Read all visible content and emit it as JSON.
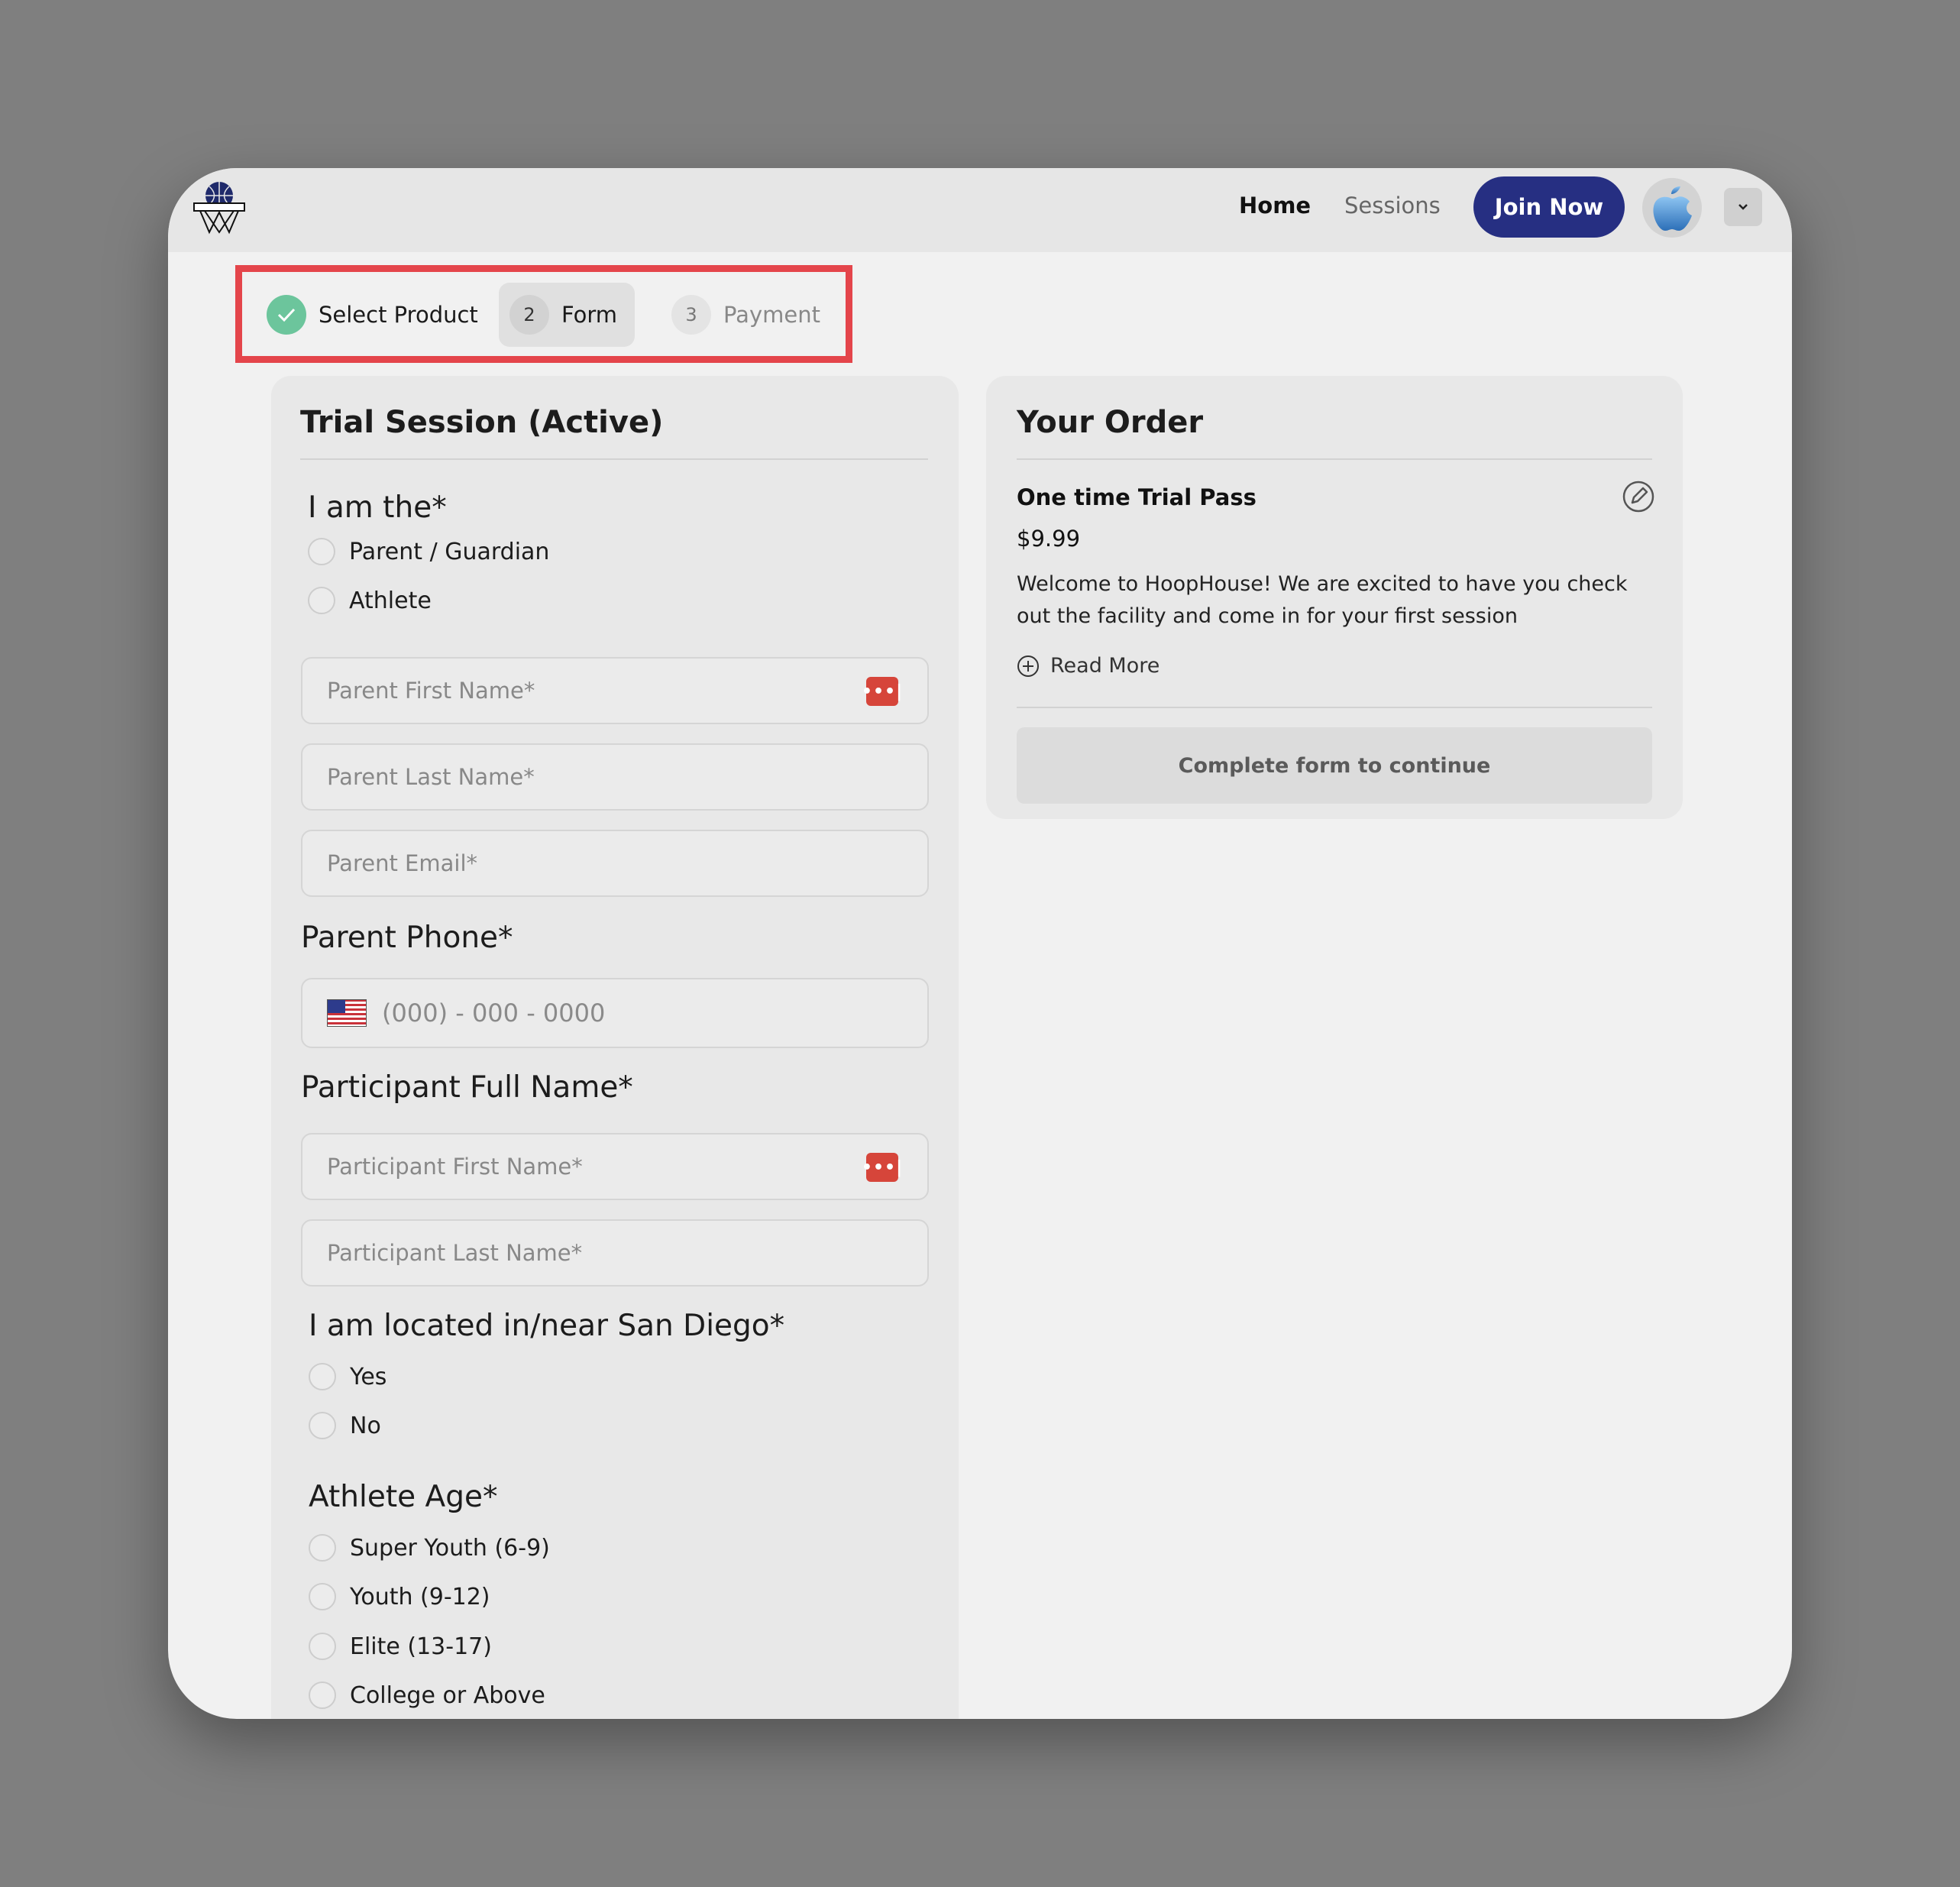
{
  "nav": {
    "home": "Home",
    "sessions": "Sessions",
    "join": "Join Now"
  },
  "stepper": {
    "steps": [
      {
        "number": "",
        "label": "Select Product",
        "status": "completed"
      },
      {
        "number": "2",
        "label": "Form",
        "status": "active"
      },
      {
        "number": "3",
        "label": "Payment",
        "status": "upcoming"
      }
    ]
  },
  "form": {
    "title": "Trial Session (Active)",
    "role": {
      "label": "I am the*",
      "options": [
        "Parent / Guardian",
        "Athlete"
      ]
    },
    "parent_first_name_placeholder": "Parent First Name*",
    "parent_last_name_placeholder": "Parent Last Name*",
    "parent_email_placeholder": "Parent Email*",
    "parent_phone": {
      "label": "Parent Phone*",
      "placeholder": "(000) - 000 - 0000"
    },
    "participant": {
      "label": "Participant Full Name*",
      "first_name_placeholder": "Participant First Name*",
      "last_name_placeholder": "Participant Last Name*"
    },
    "location": {
      "label": "I am located in/near San Diego*",
      "options": [
        "Yes",
        "No"
      ]
    },
    "age": {
      "label": "Athlete Age*",
      "options": [
        "Super Youth (6-9)",
        "Youth (9-12)",
        "Elite (13-17)",
        "College or Above"
      ]
    },
    "password_manager_glyph": "•••|"
  },
  "order": {
    "title": "Your Order",
    "item": "One time Trial Pass",
    "price": "$9.99",
    "description": "Welcome to HoopHouse! We are excited to have you check out the facility and come in for your first session",
    "read_more": "Read More",
    "continue": "Complete form to continue"
  },
  "colors": {
    "primary": "#262f82",
    "success": "#6cc59c",
    "highlight": "#e4454b",
    "password_icon": "#d6453a"
  }
}
